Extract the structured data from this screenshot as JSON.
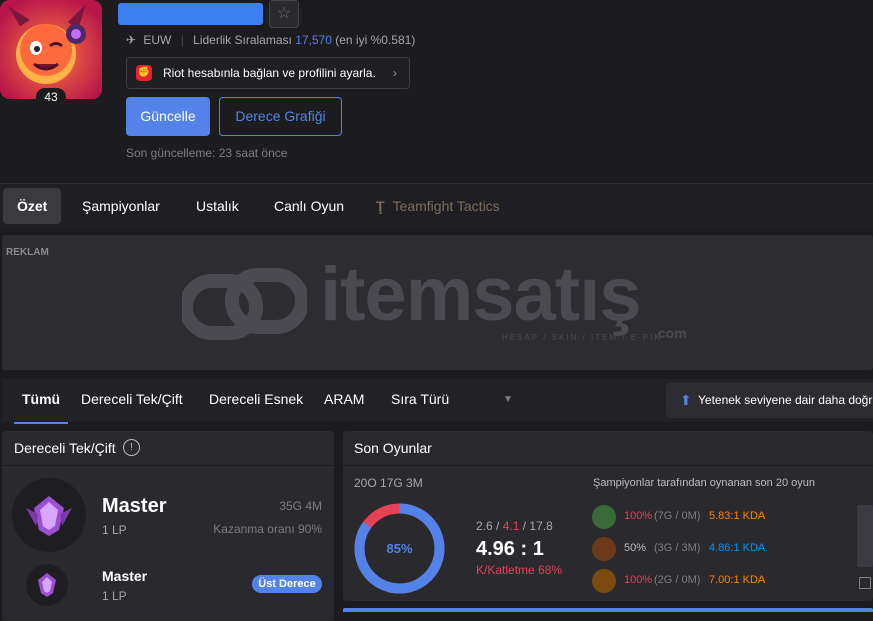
{
  "profile": {
    "level": "43",
    "region": "EUW",
    "ladder_label": "Liderlik Sıralaması",
    "ladder_rank": "17,570",
    "ladder_top": "(en iyi %0.581)",
    "riot_link_text": "Riot hesabınla bağlan ve profilini ayarla.",
    "update_button": "Güncelle",
    "rank_graph_button": "Derece Grafiği",
    "last_updated": "Son güncelleme: 23 saat önce"
  },
  "nav": {
    "tabs": [
      "Özet",
      "Şampiyonlar",
      "Ustalık",
      "Canlı Oyun",
      "Teamfight Tactics"
    ]
  },
  "ad": {
    "label": "REKLAM",
    "brand": "itemsatış",
    "tagline": "HESAP / SKIN / ITEM / E-PIN",
    "suffix": ".com"
  },
  "filters": {
    "tabs": [
      "Tümü",
      "Dereceli Tek/Çift",
      "Dereceli Esnek",
      "ARAM",
      "Sıra Türü"
    ],
    "skill_button": "Yetenek seviyene dair daha doğru"
  },
  "ranked": {
    "title": "Dereceli Tek/Çift",
    "main_tier": "Master",
    "main_lp": "1 LP",
    "main_record": "35G 4M",
    "main_winrate": "Kazanma oranı 90%",
    "second_tier": "Master",
    "second_lp": "1 LP",
    "second_badge": "Üst Derece"
  },
  "recent": {
    "title": "Son Oyunlar",
    "record": "20O 17G 3M",
    "winrate_pct": "85%",
    "winrate_value": 85,
    "kills": "2.6",
    "deaths": "4.1",
    "assists": "17.8",
    "kda_ratio": "4.96 : 1",
    "kill_participation": "K/Katletme 68%",
    "champ_caption": "Şampiyonlar tarafından oynanan son 20 oyun",
    "champions": [
      {
        "winrate": "100%",
        "record": "(7G / 0M)",
        "kda": "5.83:1 KDA",
        "wr_color": "#e84057",
        "kda_color": "#ff8200"
      },
      {
        "winrate": "50%",
        "record": "(3G / 3M)",
        "kda": "4.86:1 KDA",
        "wr_color": "#bdbdc2",
        "kda_color": "#0093ff"
      },
      {
        "winrate": "100%",
        "record": "(2G / 0M)",
        "kda": "7.00:1 KDA",
        "wr_color": "#e84057",
        "kda_color": "#ff8200"
      }
    ]
  },
  "colors": {
    "accent": "#5383e8",
    "loss": "#e84057",
    "background": "#1c1c1f",
    "panel": "#2a2a2e"
  }
}
